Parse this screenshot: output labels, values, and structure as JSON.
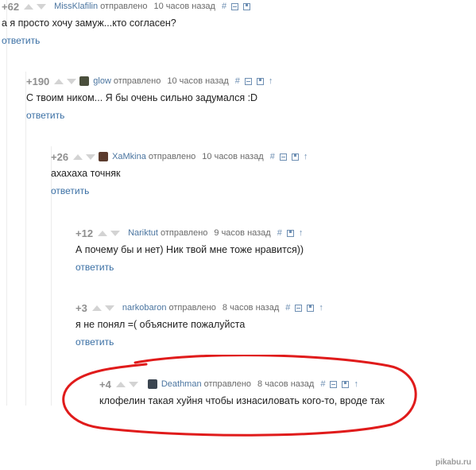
{
  "comments": [
    {
      "rating": "+62",
      "author": "MissKlafilin",
      "meta": "отправлено",
      "time": "10 часов назад",
      "text": "а я просто хочу замуж...кто согласен?",
      "reply": "ответить",
      "avatar_color": "#c3d1df"
    },
    {
      "rating": "+190",
      "author": "glow",
      "meta": "отправлено",
      "time": "10 часов назад",
      "text": "С твоим ником... Я бы очень сильно задумался :D",
      "reply": "ответить",
      "avatar_color": "#4a4f3c"
    },
    {
      "rating": "+26",
      "author": "XaMkina",
      "meta": "отправлено",
      "time": "10 часов назад",
      "text": "ахахаха точняк",
      "reply": "ответить",
      "avatar_color": "#5b3b2d"
    },
    {
      "rating": "+12",
      "author": "Nariktut",
      "meta": "отправлено",
      "time": "9 часов назад",
      "text": "А почему бы и нет) Ник твой мне тоже нравится))",
      "reply": "ответить",
      "avatar_color": ""
    },
    {
      "rating": "+3",
      "author": "narkobaron",
      "meta": "отправлено",
      "time": "8 часов назад",
      "text": "я не понял =( объясните пожалуйста",
      "reply": "ответить",
      "avatar_color": ""
    },
    {
      "rating": "+4",
      "author": "Deathman",
      "meta": "отправлено",
      "time": "8 часов назад",
      "text": "клофелин такая хуйня чтобы изнасиловать кого-то, вроде так",
      "reply": "",
      "avatar_color": "#3b4550"
    }
  ],
  "tools": {
    "hash": "#",
    "up": "↑"
  },
  "watermark": "pikabu.ru",
  "colors": {
    "link": "#3a6fa4",
    "author": "#4b75a0",
    "highlight": "#e01b1b"
  }
}
